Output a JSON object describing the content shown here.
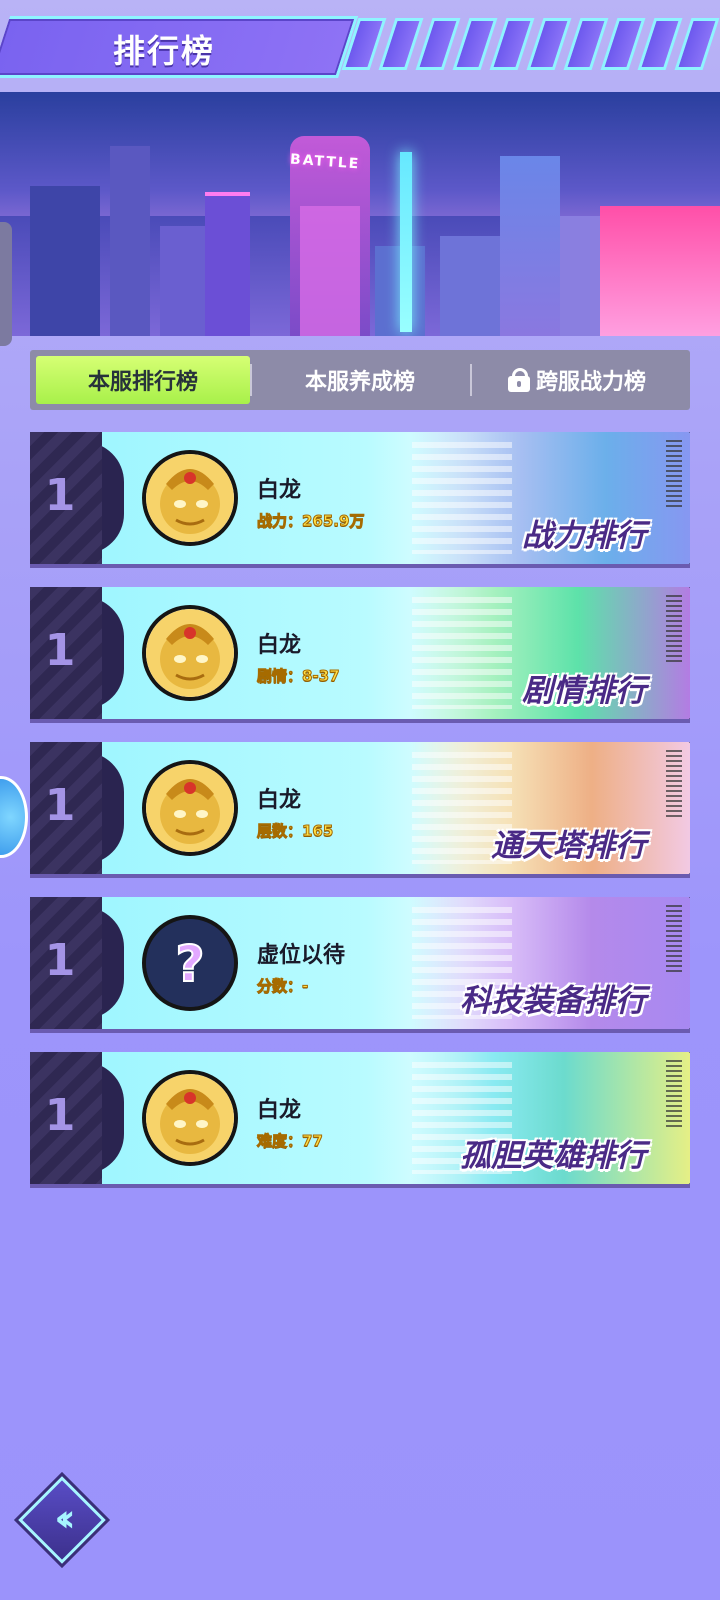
{
  "header": {
    "title": "排行榜"
  },
  "banner": {
    "sign": "BATTLE"
  },
  "tabs": [
    {
      "label": "本服排行榜",
      "active": true,
      "locked": false
    },
    {
      "label": "本服养成榜",
      "active": false,
      "locked": false
    },
    {
      "label": "跨服战力榜",
      "active": false,
      "locked": true
    }
  ],
  "rankings": [
    {
      "rank": "1",
      "name": "白龙",
      "stat": "战力：265.9万",
      "title": "战力排行",
      "avatar": "golden-hero"
    },
    {
      "rank": "1",
      "name": "白龙",
      "stat": "剧情：8-37",
      "title": "剧情排行",
      "avatar": "golden-hero"
    },
    {
      "rank": "1",
      "name": "白龙",
      "stat": "层数：165",
      "title": "通天塔排行",
      "avatar": "golden-hero"
    },
    {
      "rank": "1",
      "name": "虚位以待",
      "stat": "分数：-",
      "title": "科技装备排行",
      "avatar": "question-mark"
    },
    {
      "rank": "1",
      "name": "白龙",
      "stat": "难度：77",
      "title": "孤胆英雄排行",
      "avatar": "golden-hero"
    }
  ],
  "colors": {
    "accent": "#a8f04a",
    "title_text": "#4a2a86",
    "stat_text": "#ffe14a",
    "background": "#9d95fb"
  }
}
